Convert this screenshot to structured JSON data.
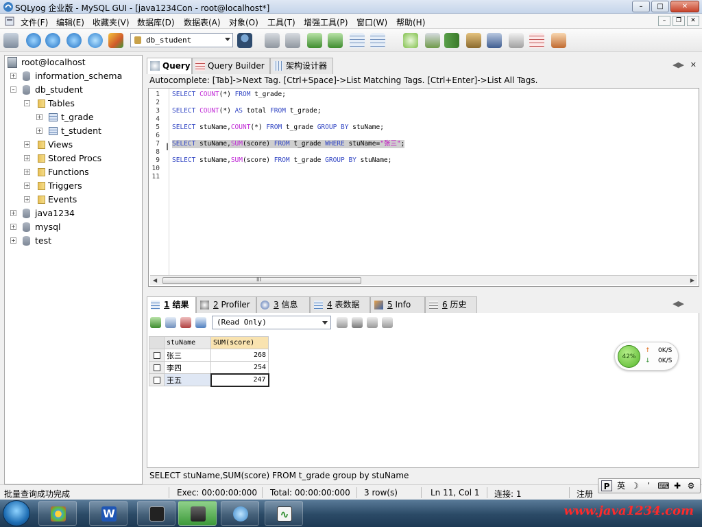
{
  "window": {
    "title": "SQLyog 企业版 - MySQL GUI - [java1234Con - root@localhost*]"
  },
  "menu": [
    "文件(F)",
    "编辑(E)",
    "收藏夹(V)",
    "数据库(D)",
    "数据表(A)",
    "对象(O)",
    "工具(T)",
    "增强工具(P)",
    "窗口(W)",
    "帮助(H)"
  ],
  "toolbar": {
    "database_selector": "db_student"
  },
  "object_browser": {
    "root": "root@localhost",
    "items": [
      {
        "label": "information_schema"
      },
      {
        "label": "db_student"
      },
      {
        "label": "Tables"
      },
      {
        "label": "t_grade"
      },
      {
        "label": "t_student"
      },
      {
        "label": "Views"
      },
      {
        "label": "Stored Procs"
      },
      {
        "label": "Functions"
      },
      {
        "label": "Triggers"
      },
      {
        "label": "Events"
      },
      {
        "label": "java1234"
      },
      {
        "label": "mysql"
      },
      {
        "label": "test"
      }
    ]
  },
  "query_tabs": [
    "Query",
    "Query Builder",
    "架构设计器"
  ],
  "autocomplete_hint": "Autocomplete: [Tab]->Next Tag. [Ctrl+Space]->List Matching Tags. [Ctrl+Enter]->List All Tags.",
  "editor": {
    "line_numbers": [
      "1",
      "2",
      "3",
      "4",
      "5",
      "6",
      "7",
      "8",
      "9",
      "10",
      "11"
    ],
    "lines": {
      "l1": [
        "SELECT",
        " ",
        "COUNT",
        "(*) ",
        "FROM",
        " t_grade;"
      ],
      "l3": [
        "SELECT",
        " ",
        "COUNT",
        "(*) ",
        "AS",
        " total ",
        "FROM",
        " t_grade;"
      ],
      "l5": [
        "SELECT",
        " stuName,",
        "COUNT",
        "(*) ",
        "FROM",
        " t_grade ",
        "GROUP BY",
        " stuName;"
      ],
      "l7": [
        "SELECT",
        " stuName,",
        "SUM",
        "(score) ",
        "FROM",
        " t_grade ",
        "WHERE",
        " stuName=",
        "\"张三\"",
        ";"
      ],
      "l9": [
        "SELECT",
        " stuName,",
        "SUM",
        "(score) ",
        "FROM",
        " t_grade ",
        "GROUP BY",
        " stuName;"
      ]
    },
    "scroll_mark": "III"
  },
  "result_tabs": [
    {
      "num": "1",
      "label": "结果"
    },
    {
      "num": "2",
      "label": "Profiler"
    },
    {
      "num": "3",
      "label": "信息"
    },
    {
      "num": "4",
      "label": "表数据"
    },
    {
      "num": "5",
      "label": "Info"
    },
    {
      "num": "6",
      "label": "历史"
    }
  ],
  "result_mode": "(Read Only)",
  "result_grid": {
    "columns": [
      "stuName",
      "SUM(score)"
    ],
    "rows": [
      [
        "张三",
        "268"
      ],
      [
        "李四",
        "254"
      ],
      [
        "王五",
        "247"
      ]
    ]
  },
  "sql_status": "SELECT stuName,SUM(score) FROM t_grade group by stuName",
  "statusbar": {
    "message": "批量查询成功完成",
    "exec": "Exec: 00:00:00:000",
    "total": "Total: 00:00:00:000",
    "rows": "3 row(s)",
    "position": "Ln 11, Col 1",
    "connections": "连接: 1",
    "register": "注册"
  },
  "ime": {
    "mode": "英"
  },
  "net_widget": {
    "percent": "42%",
    "up": "0K/S",
    "down": "0K/S"
  },
  "taskbar": {
    "watermark": "www.java1234.com"
  },
  "colors": {
    "keyword": "#3347c4",
    "function": "#c02ad6",
    "string": "#c000c0",
    "watermark": "#ff2a2a"
  }
}
